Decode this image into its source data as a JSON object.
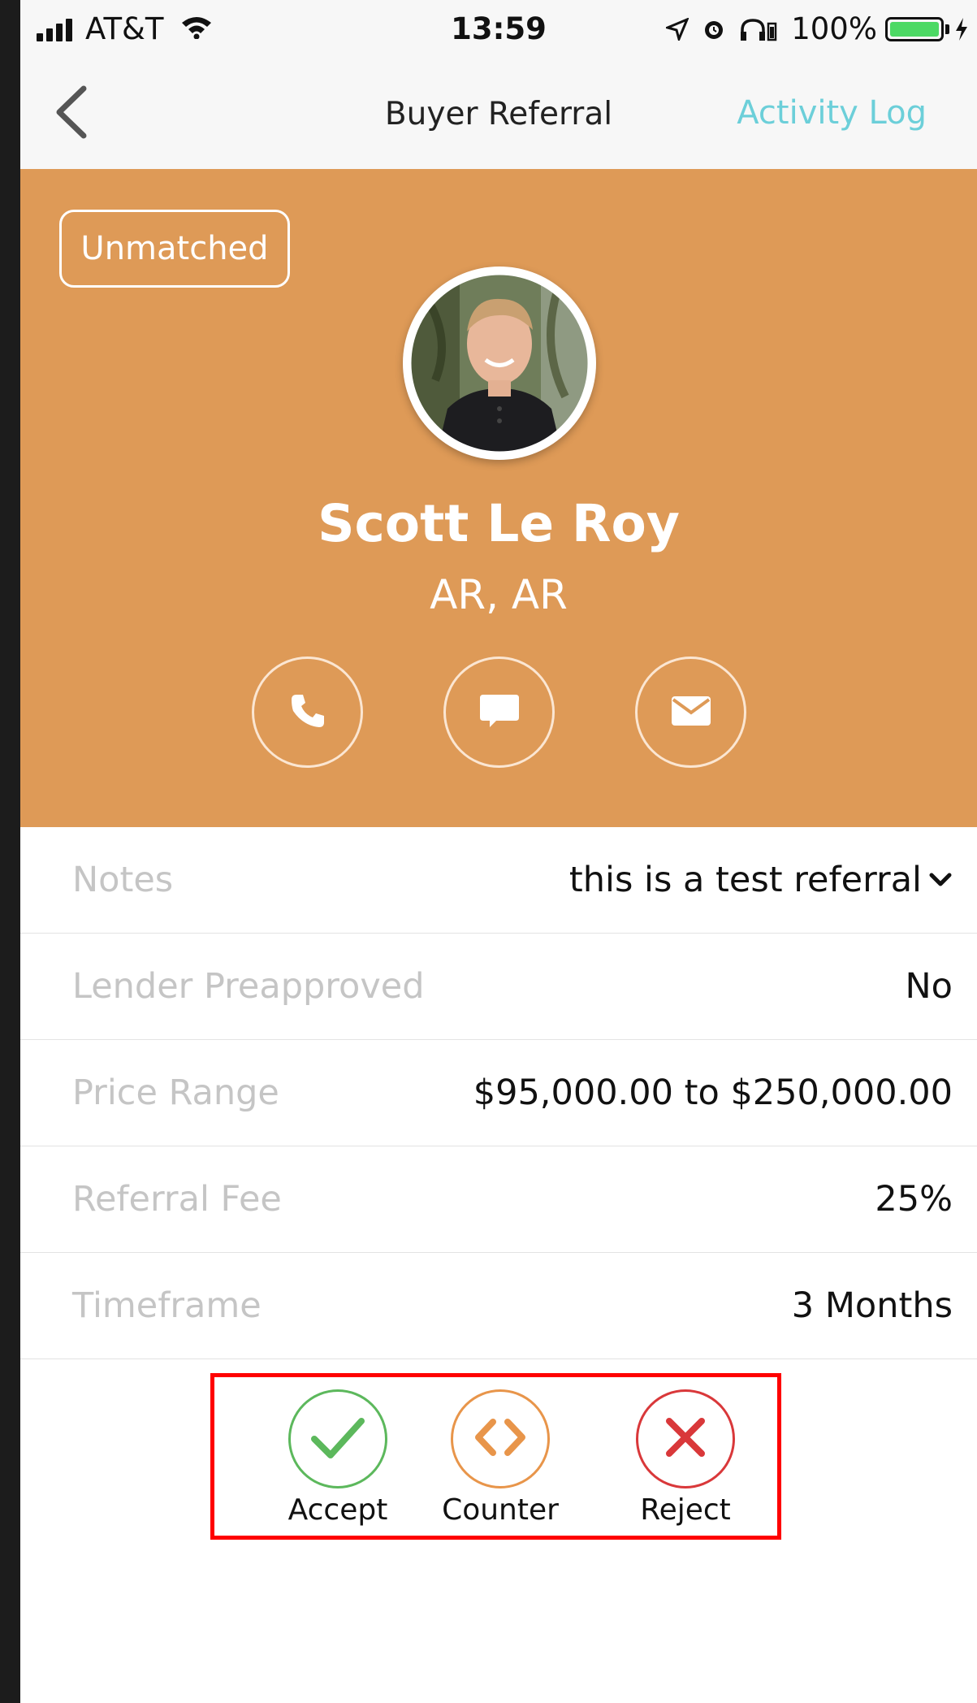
{
  "status_bar": {
    "carrier": "AT&T",
    "time": "13:59",
    "battery": "100%"
  },
  "nav": {
    "title": "Buyer Referral",
    "activity_log": "Activity Log",
    "back_icon": "chevron-left-icon",
    "accent_color": "#6ccfd9"
  },
  "profile": {
    "badge": "Unmatched",
    "name": "Scott Le Roy",
    "location": "AR, AR",
    "background_color": "#de9a57",
    "contact_icons": [
      "phone-icon",
      "chat-icon",
      "mail-icon"
    ]
  },
  "details": [
    {
      "label": "Notes",
      "value": "this is a test referral"
    },
    {
      "label": "Lender Preapproved",
      "value": "No"
    },
    {
      "label": "Price Range",
      "value": "$95,000.00 to $250,000.00"
    },
    {
      "label": "Referral Fee",
      "value": "25%"
    },
    {
      "label": "Timeframe",
      "value": "3 Months"
    }
  ],
  "actions": {
    "accept": {
      "label": "Accept",
      "color": "#5cb85c"
    },
    "counter": {
      "label": "Counter",
      "color": "#e8954a"
    },
    "reject": {
      "label": "Reject",
      "color": "#d9383a"
    }
  }
}
